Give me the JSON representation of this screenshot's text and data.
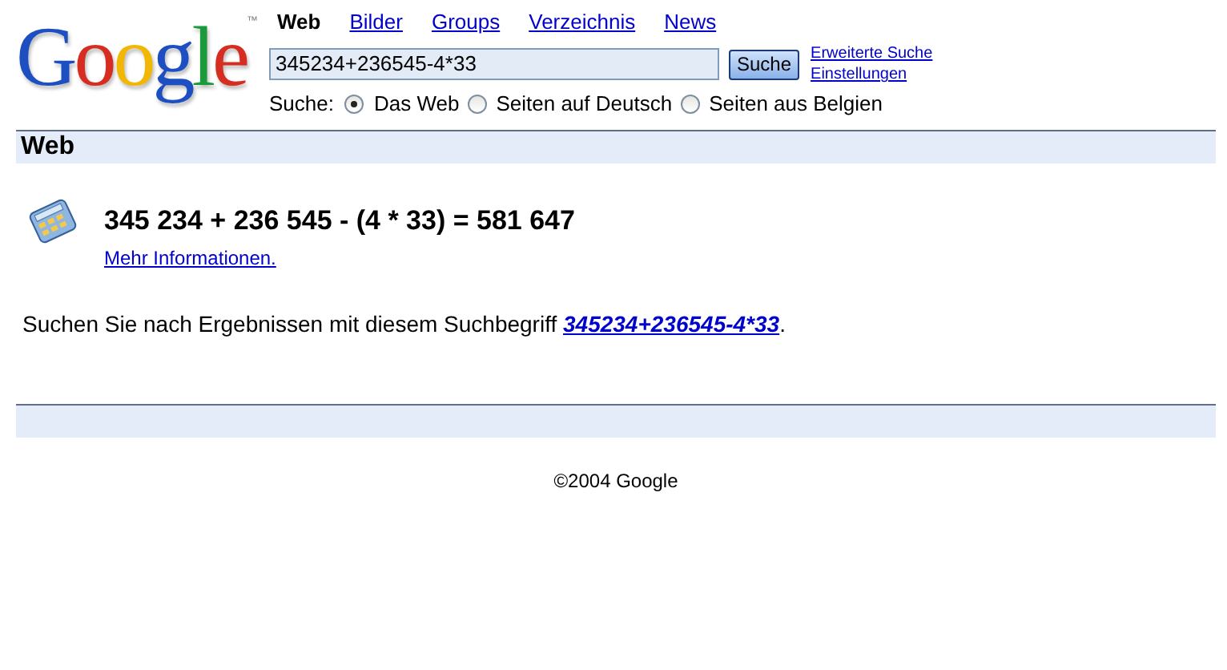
{
  "logo": {
    "text": "Google",
    "mark": "™"
  },
  "tabs": [
    {
      "label": "Web",
      "selected": true
    },
    {
      "label": "Bilder",
      "selected": false
    },
    {
      "label": "Groups",
      "selected": false
    },
    {
      "label": "Verzeichnis",
      "selected": false
    },
    {
      "label": "News",
      "selected": false
    }
  ],
  "search": {
    "value": "345234+236545-4*33",
    "button": "Suche",
    "links": [
      "Erweiterte Suche",
      "Einstellungen"
    ]
  },
  "scope": {
    "label": "Suche:",
    "options": [
      {
        "label": "Das Web",
        "selected": true
      },
      {
        "label": "Seiten auf Deutsch",
        "selected": false
      },
      {
        "label": "Seiten aus Belgien",
        "selected": false
      }
    ]
  },
  "section_title": "Web",
  "calculator": {
    "result": "345 234 + 236 545 - (4 * 33) = 581 647",
    "more_link": "Mehr Informationen."
  },
  "suggestion": {
    "before": "Suchen Sie nach Ergebnissen mit diesem Suchbegriff ",
    "link": "345234+236545-4*33",
    "after": "."
  },
  "footer": "©2004 Google"
}
